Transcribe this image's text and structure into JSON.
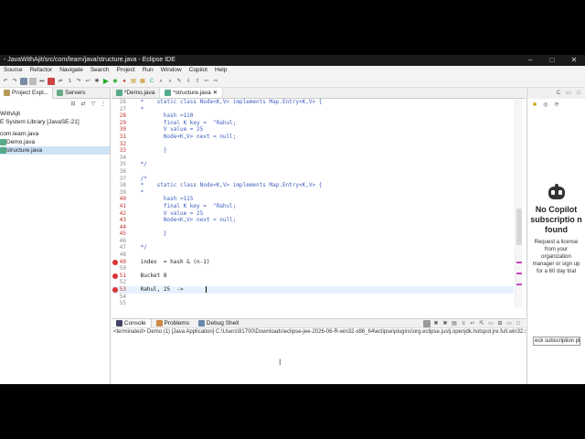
{
  "window": {
    "title": "- JavaWithAjit/src/com/learn/java/structure.java - Eclipse IDE",
    "controls": [
      "–",
      "□",
      "✕"
    ]
  },
  "menu": [
    "Source",
    "Refactor",
    "Navigate",
    "Search",
    "Project",
    "Run",
    "Window",
    "Copilot",
    "Help"
  ],
  "left_panel": {
    "tabs": [
      "Project Expl...",
      "Servers"
    ],
    "tree": [
      "WithAjit",
      "E System Library [JavaSE-21]",
      "com.learn.java",
      "Demo.java",
      "structure.java"
    ]
  },
  "editor": {
    "tabs": [
      "*Demo.java",
      "*structure.java"
    ],
    "lines": [
      {
        "n": "26",
        "text": " *    static class Node<K,V> implements Map.Entry<K,V> {",
        "style": "comment"
      },
      {
        "n": "27",
        "text": " *",
        "style": "comment"
      },
      {
        "n": "28",
        "text": "        hash =110",
        "style": "comment",
        "red": true
      },
      {
        "n": "29",
        "text": "        final K key =  \"Rahul;",
        "style": "comment",
        "red": true
      },
      {
        "n": "30",
        "text": "        V value = 25",
        "style": "comment",
        "red": true
      },
      {
        "n": "31",
        "text": "        Node<K,V> next = null;",
        "style": "comment",
        "red": true
      },
      {
        "n": "32",
        "text": "",
        "style": "comment",
        "red": true
      },
      {
        "n": "33",
        "text": "        }",
        "style": "comment",
        "red": true
      },
      {
        "n": "34",
        "text": "",
        "style": "comment"
      },
      {
        "n": "35",
        "text": " */",
        "style": "comment"
      },
      {
        "n": "36",
        "text": "",
        "style": "comment"
      },
      {
        "n": "37",
        "text": " /*",
        "style": "comment"
      },
      {
        "n": "38",
        "text": " *    static class Node<K,V> implements Map.Entry<K,V> {",
        "style": "comment"
      },
      {
        "n": "39",
        "text": " *",
        "style": "comment"
      },
      {
        "n": "40",
        "text": "        hash =115",
        "style": "comment",
        "red": true
      },
      {
        "n": "41",
        "text": "        final K key =  \"Rahul;",
        "style": "comment",
        "red": true
      },
      {
        "n": "42",
        "text": "        V value = 25",
        "style": "comment",
        "red": true
      },
      {
        "n": "43",
        "text": "        Node<K,V> next = null;",
        "style": "comment",
        "red": true
      },
      {
        "n": "44",
        "text": "",
        "style": "comment",
        "red": true
      },
      {
        "n": "45",
        "text": "        }",
        "style": "comment",
        "red": true
      },
      {
        "n": "46",
        "text": "",
        "style": "comment"
      },
      {
        "n": "47",
        "text": " */",
        "style": "comment"
      },
      {
        "n": "48",
        "text": "",
        "style": "plain"
      },
      {
        "n": "49",
        "text": " index  = hash & (n-1)",
        "style": "plain",
        "error": true
      },
      {
        "n": "50",
        "text": "",
        "style": "plain"
      },
      {
        "n": "51",
        "text": " Bucket 8",
        "style": "plain",
        "error": true
      },
      {
        "n": "52",
        "text": "",
        "style": "plain"
      },
      {
        "n": "53",
        "text": " Rahul, 25  ->",
        "style": "plain",
        "error": true,
        "current": true
      },
      {
        "n": "54",
        "text": "",
        "style": "plain"
      },
      {
        "n": "55",
        "text": "",
        "style": "plain"
      }
    ]
  },
  "copilot": {
    "title": "No Copilot subscriptio n found",
    "description": "Request a license from your organization manager or sign up for a 60 day trial",
    "input_value": "eck subscription pl"
  },
  "console": {
    "tabs": [
      "Console",
      "Problems",
      "Debug Shell"
    ],
    "status": "<terminated> Demo (1) [Java Application] C:\\Users\\91700\\Downloads\\eclipse-jee-2026-06-R-win32-x86_64\\eclipse\\plugins\\org.eclipse.justj.openjdk.hotspot.jre.full.win32.x86"
  },
  "colors": {
    "comment": "#3f5fbf",
    "error": "#dd3333",
    "selection": "#cfe3f7",
    "current_line": "#e8f2fe"
  }
}
